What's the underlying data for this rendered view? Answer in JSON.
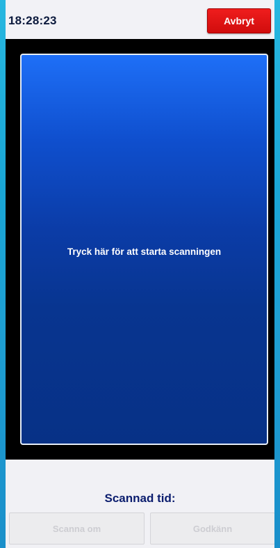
{
  "header": {
    "clock": "18:28:23",
    "cancel_label": "Avbryt"
  },
  "scan_area": {
    "instruction": "Tryck här för att starta scanningen"
  },
  "footer": {
    "scanned_time_label": "Scannad tid:",
    "rescan_label": "Scanna om",
    "approve_label": "Godkänn"
  },
  "colors": {
    "cancel_button": "#e01414",
    "scan_area_top": "#1e6ff7",
    "scan_area_bottom": "#073186",
    "label_text": "#0b1d6e"
  }
}
